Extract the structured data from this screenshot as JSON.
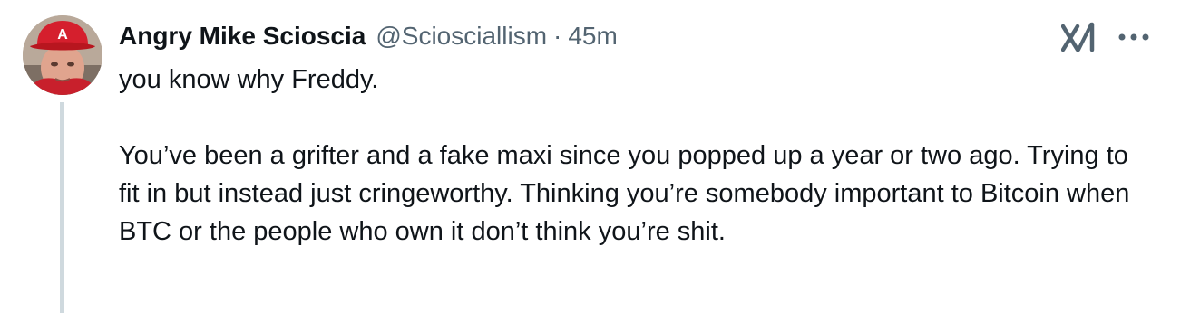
{
  "tweet": {
    "author": {
      "display_name": "Angry Mike Scioscia",
      "handle": "@Sciosciallism",
      "avatar_icon": "avatar-photo"
    },
    "separator": "·",
    "time": "45m",
    "text": "you know why Freddy.\n\nYou’ve been a grifter and a fake maxi since you popped up a year or two ago. Trying to fit in but instead just cringeworthy. Thinking you’re somebody important to Bitcoin when BTC or the people who own it don’t think you’re shit.",
    "actions": {
      "grok_icon": "grok-icon",
      "more_icon": "more-icon"
    }
  },
  "colors": {
    "text": "#0f1419",
    "secondary": "#536471",
    "thread_line": "#cfd9de"
  }
}
